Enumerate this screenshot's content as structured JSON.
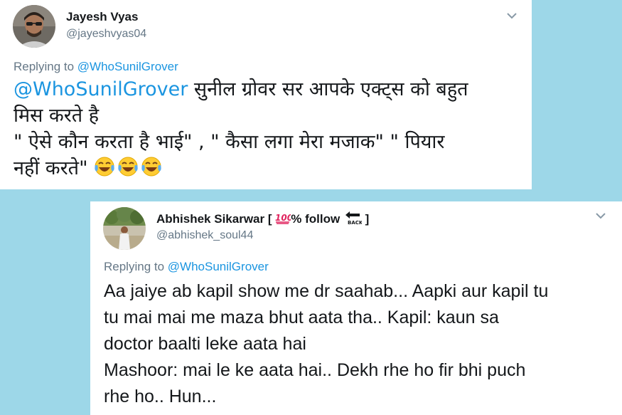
{
  "tweet1": {
    "author_name": "Jayesh Vyas",
    "author_handle": "@jayeshvyas04",
    "reply_prefix": "Replying to",
    "reply_to": "@WhoSunilGrover",
    "mention": "@WhoSunilGrover",
    "line1_rest": " सुनील ग्रोवर सर आपके एक्ट्स को बहुत",
    "line2": "मिस करते है",
    "line3": " \" ऐसे कौन करता है भाई\" , \" कैसा लगा मेरा मजाक\" \" पियार",
    "line4": "नहीं करते\" ",
    "emojis": [
      "laughing-tears-emoji",
      "laughing-tears-emoji",
      "laughing-tears-emoji"
    ]
  },
  "tweet2": {
    "author_name_prefix": "Abhishek Sikarwar [ ",
    "author_name_mid": "% follow ",
    "author_name_suffix": " ]",
    "author_handle": "@abhishek_soul44",
    "reply_prefix": "Replying to",
    "reply_to": "@WhoSunilGrover",
    "body": "Aa jaiye ab kapil show me dr saahab... Aapki aur kapil tu\ntu mai mai me maza bhut aata tha.. Kapil: kaun sa\ndoctor baalti leke aata hai\nMashoor: mai le ke aata hai.. Dekh rhe ho fir bhi puch\nrhe ho.. Hun..."
  },
  "colors": {
    "background": "#9dd7e8",
    "card": "#ffffff",
    "mention": "#1b95e0",
    "secondary_text": "#657786",
    "primary_text": "#14171a"
  },
  "icons": [
    "chevron-down-icon",
    "hundred-points-emoji",
    "back-arrow-emoji",
    "laughing-tears-emoji"
  ]
}
